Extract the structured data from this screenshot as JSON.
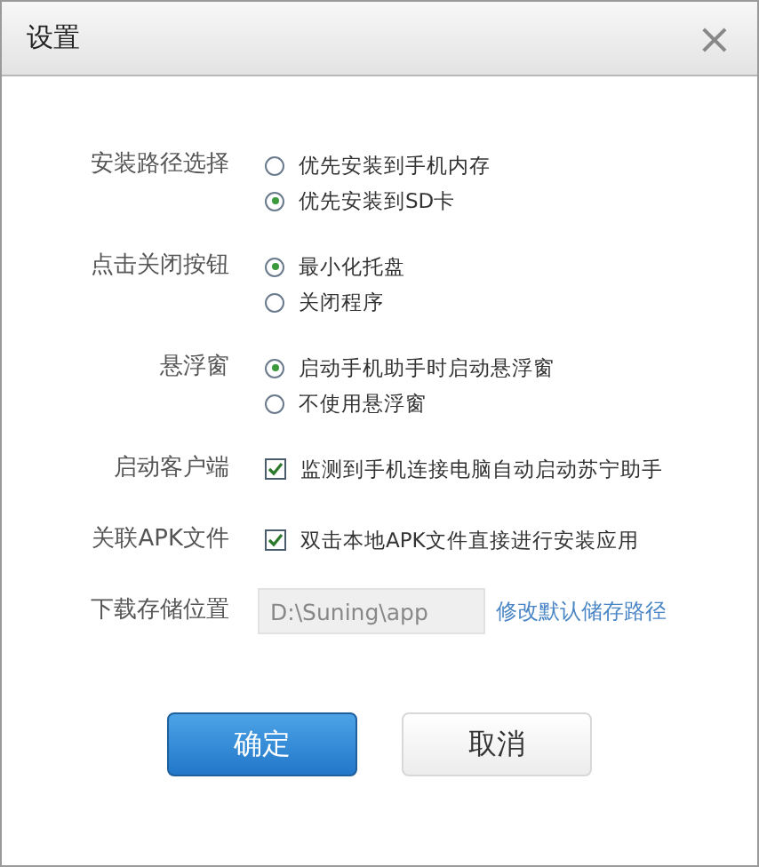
{
  "window": {
    "title": "设置",
    "close": "×"
  },
  "sections": [
    {
      "kind": "radio",
      "label": "安装路径选择",
      "options": [
        {
          "label": "优先安装到手机内存",
          "selected": false
        },
        {
          "label": "优先安装到SD卡",
          "selected": true
        }
      ]
    },
    {
      "kind": "radio",
      "label": "点击关闭按钮",
      "options": [
        {
          "label": "最小化托盘",
          "selected": true
        },
        {
          "label": "关闭程序",
          "selected": false
        }
      ]
    },
    {
      "kind": "radio",
      "label": "悬浮窗",
      "options": [
        {
          "label": "启动手机助手时启动悬浮窗",
          "selected": true
        },
        {
          "label": "不使用悬浮窗",
          "selected": false
        }
      ]
    },
    {
      "kind": "checkbox",
      "label": "启动客户端",
      "options": [
        {
          "label": "监测到手机连接电脑自动启动苏宁助手",
          "checked": true
        }
      ]
    },
    {
      "kind": "checkbox",
      "label": "关联APK文件",
      "options": [
        {
          "label": "双击本地APK文件直接进行安装应用",
          "checked": true
        }
      ]
    },
    {
      "kind": "path",
      "label": "下载存储位置",
      "value": "D:\\Suning\\app",
      "link": "修改默认储存路径"
    }
  ],
  "buttons": [
    {
      "kind": "primary",
      "label": "确定"
    },
    {
      "kind": "secondary",
      "label": "取消"
    }
  ]
}
